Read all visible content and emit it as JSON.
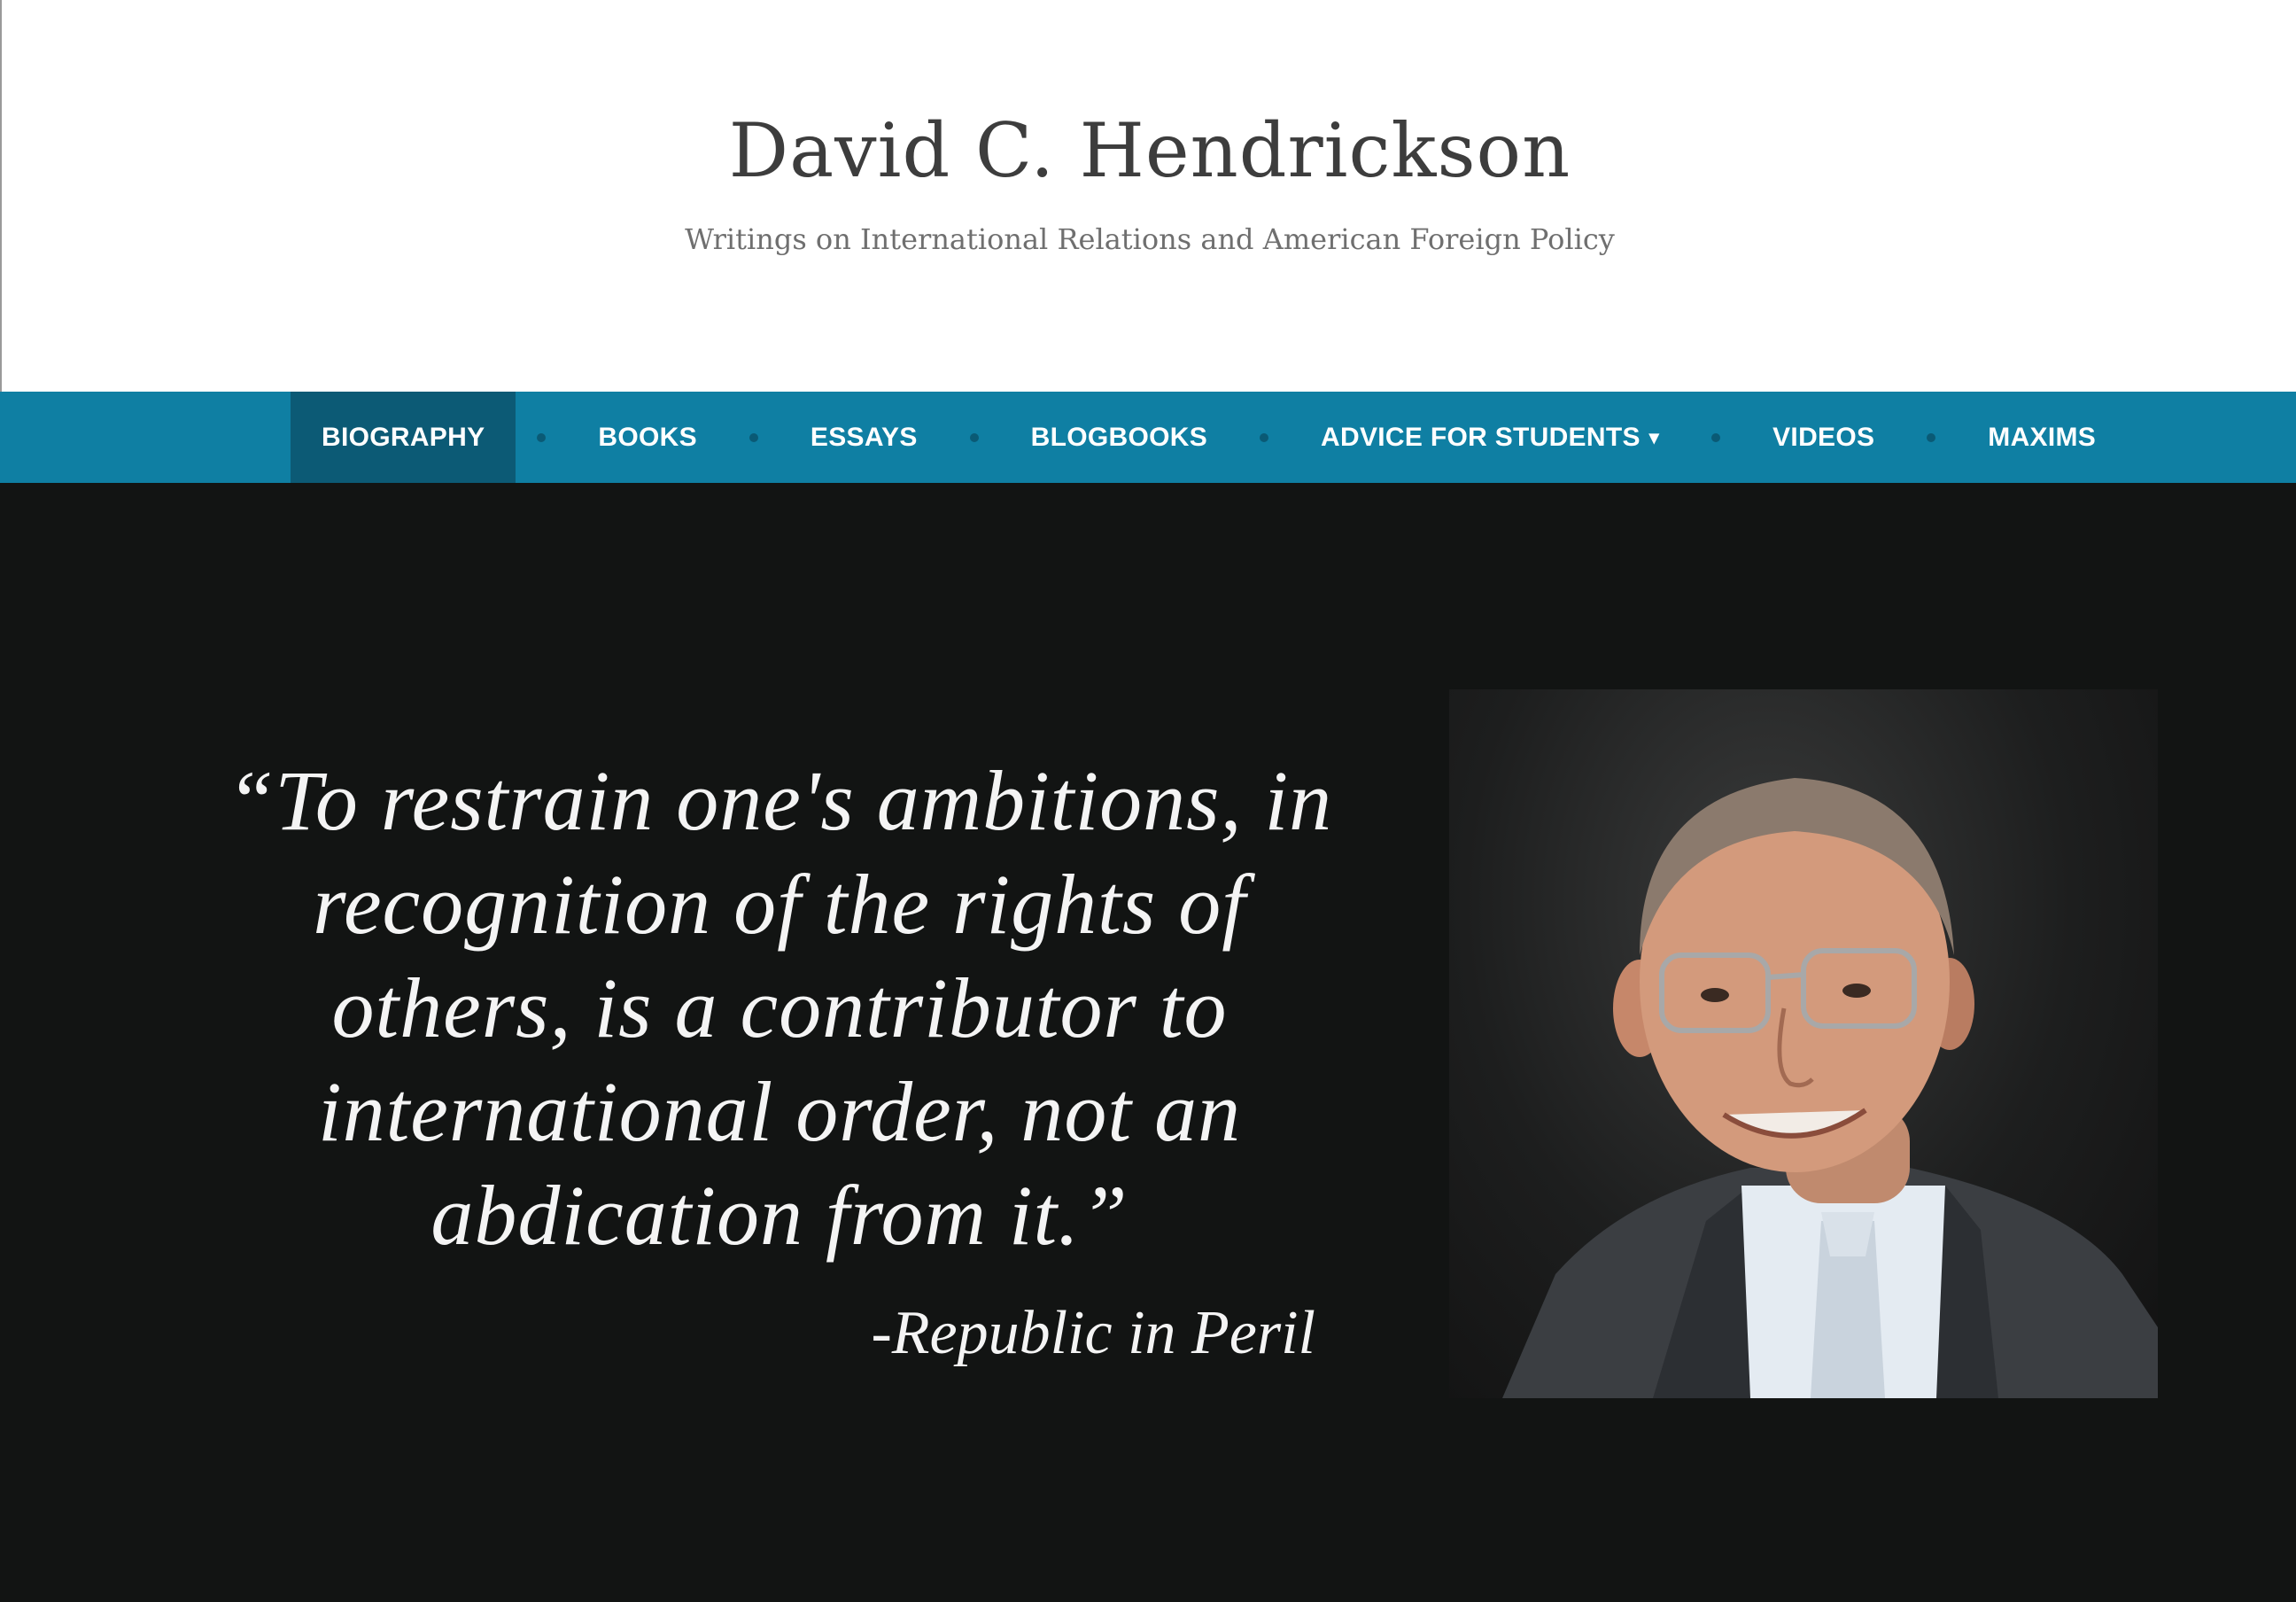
{
  "site": {
    "title": "David C. Hendrickson",
    "tagline": "Writings on International Relations and American Foreign Policy"
  },
  "nav": {
    "items": [
      {
        "label": "BIOGRAPHY",
        "active": true
      },
      {
        "label": "BOOKS"
      },
      {
        "label": "ESSAYS"
      },
      {
        "label": "BLOGBOOKS"
      },
      {
        "label": "ADVICE FOR STUDENTS",
        "has_dropdown": true,
        "dropdown_icon": "caret-down-icon"
      },
      {
        "label": "VIDEOS"
      },
      {
        "label": "MAXIMS"
      }
    ],
    "caret_glyph": "▾"
  },
  "hero": {
    "quote": "“To restrain one's ambitions, in recognition of the rights of others, is a contributor to international order, not an abdication from it.”",
    "attribution": "-Republic in Peril"
  },
  "colors": {
    "nav_bg": "#0f7fa3",
    "nav_active_bg": "#0c5a75",
    "hero_bg": "#121413",
    "title_text": "#3d3d3d",
    "tagline_text": "#6f6f6f"
  }
}
